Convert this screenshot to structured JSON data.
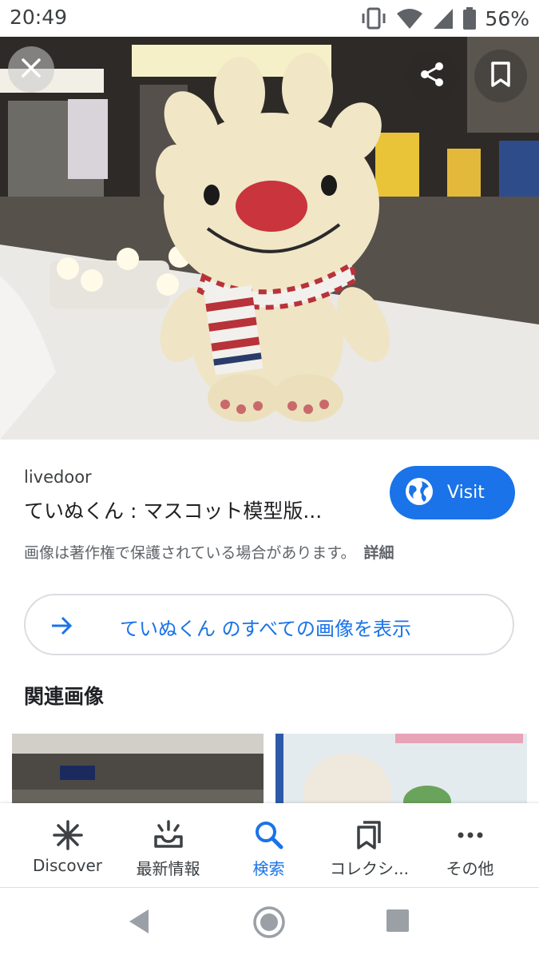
{
  "status_bar": {
    "time": "20:49",
    "battery_percent": "56%"
  },
  "hero": {
    "alt": "ていぬくん mascot in snow",
    "close_icon": "close-icon",
    "share_icon": "share-icon",
    "save_icon": "bookmark-icon"
  },
  "result": {
    "source": "livedoor",
    "title": "ていぬくん : マスコット模型版...",
    "visit_label": "Visit",
    "copyright_notice": "画像は著作権で保護されている場合があります。",
    "details_link": "詳細"
  },
  "all_images": {
    "label": "ていぬくん のすべての画像を表示"
  },
  "related": {
    "title": "関連画像"
  },
  "bottom_nav": {
    "items": [
      {
        "label": "Discover",
        "icon": "asterisk-icon"
      },
      {
        "label": "最新情報",
        "icon": "updates-icon"
      },
      {
        "label": "検索",
        "icon": "search-icon"
      },
      {
        "label": "コレクシ...",
        "icon": "collections-icon"
      },
      {
        "label": "その他",
        "icon": "more-icon"
      }
    ],
    "active_index": 2
  },
  "colors": {
    "accent": "#1a73e8",
    "text_primary": "#202124",
    "text_secondary": "#5f6368"
  }
}
